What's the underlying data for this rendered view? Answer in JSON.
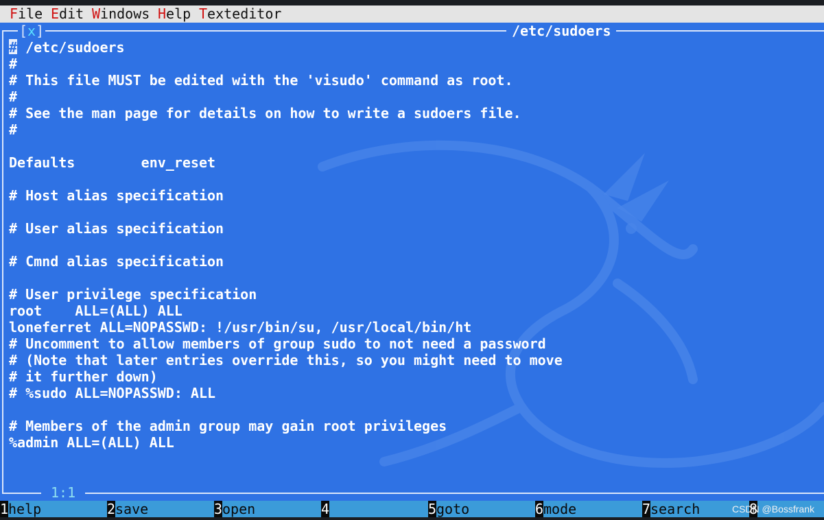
{
  "menubar": {
    "items": [
      {
        "hot": "F",
        "rest": "ile"
      },
      {
        "hot": "E",
        "rest": "dit"
      },
      {
        "hot": "W",
        "rest": "indows"
      },
      {
        "hot": "H",
        "rest": "elp"
      },
      {
        "hot": "T",
        "rest": "exteditor"
      }
    ]
  },
  "window": {
    "close_label": "[",
    "close_x": "x",
    "close_end": "]",
    "title": "/etc/sudoers",
    "cursor_position": "1:1"
  },
  "file": {
    "lines": [
      "# /etc/sudoers",
      "#",
      "# This file MUST be edited with the 'visudo' command as root.",
      "#",
      "# See the man page for details on how to write a sudoers file.",
      "#",
      "",
      "Defaults        env_reset",
      "",
      "# Host alias specification",
      "",
      "# User alias specification",
      "",
      "# Cmnd alias specification",
      "",
      "# User privilege specification",
      "root    ALL=(ALL) ALL",
      "loneferret ALL=NOPASSWD: !/usr/bin/su, /usr/local/bin/ht",
      "# Uncomment to allow members of group sudo to not need a password",
      "# (Note that later entries override this, so you might need to move",
      "# it further down)",
      "# %sudo ALL=NOPASSWD: ALL",
      "",
      "# Members of the admin group may gain root privileges",
      "%admin ALL=(ALL) ALL"
    ],
    "cursor_char": "#"
  },
  "fkeys": [
    {
      "num": "1",
      "label": "help"
    },
    {
      "num": "2",
      "label": "save"
    },
    {
      "num": "3",
      "label": "open"
    },
    {
      "num": "4",
      "label": ""
    },
    {
      "num": "5",
      "label": "goto"
    },
    {
      "num": "6",
      "label": "mode"
    },
    {
      "num": "7",
      "label": "search"
    },
    {
      "num": "8",
      "label": ""
    }
  ],
  "watermark": "CSDN @Bossfrank",
  "colors": {
    "editor_bg": "#2f72e4",
    "menubar_bg": "#e4e4e4",
    "fkey_bar_bg": "#3b9bd9",
    "hotkey_red": "#d01010"
  }
}
